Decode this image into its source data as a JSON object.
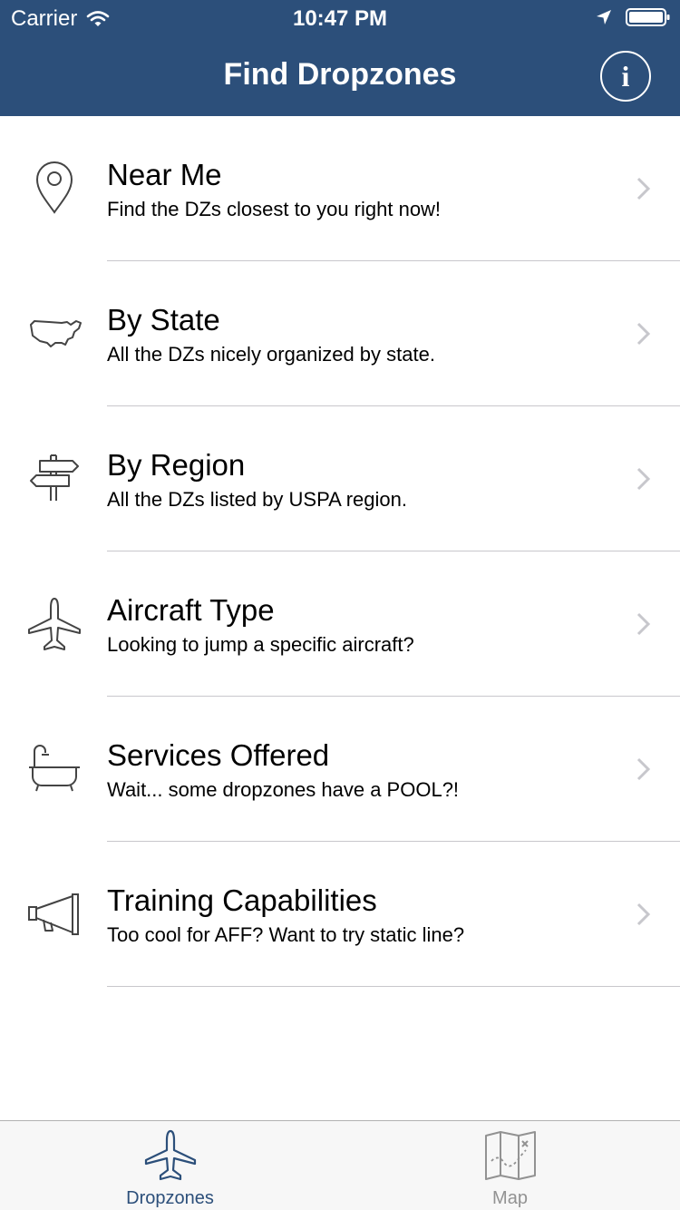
{
  "status_bar": {
    "carrier": "Carrier",
    "time": "10:47 PM",
    "icons": [
      "wifi-icon",
      "location-arrow-icon",
      "battery-icon"
    ]
  },
  "nav": {
    "title": "Find Dropzones",
    "info_label": "i",
    "bar_color": "#2c4f7a"
  },
  "menu": {
    "items": [
      {
        "title": "Near Me",
        "subtitle": "Find the DZs closest to you right now!",
        "icon": "location-pin-icon"
      },
      {
        "title": "By State",
        "subtitle": "All the DZs nicely organized by state.",
        "icon": "usa-map-icon"
      },
      {
        "title": "By Region",
        "subtitle": "All the DZs listed by USPA region.",
        "icon": "signpost-icon"
      },
      {
        "title": "Aircraft Type",
        "subtitle": "Looking to jump a specific aircraft?",
        "icon": "airplane-icon"
      },
      {
        "title": "Services Offered",
        "subtitle": "Wait... some dropzones have a POOL?!",
        "icon": "bathtub-icon"
      },
      {
        "title": "Training Capabilities",
        "subtitle": "Too cool for AFF? Want to try static line?",
        "icon": "megaphone-icon"
      }
    ]
  },
  "tabbar": {
    "tabs": [
      {
        "label": "Dropzones",
        "icon": "airplane-icon",
        "active": true
      },
      {
        "label": "Map",
        "icon": "treasure-map-icon",
        "active": false
      }
    ],
    "active_color": "#2c4f7a",
    "inactive_color": "#929292"
  }
}
